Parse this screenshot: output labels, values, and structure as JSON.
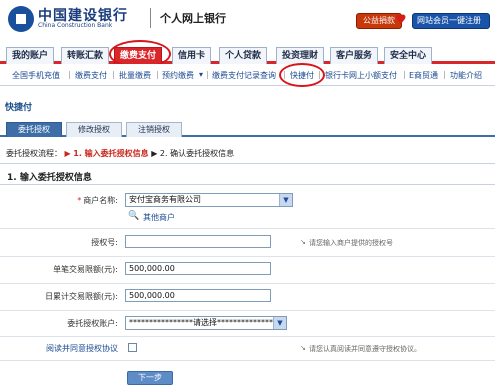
{
  "header": {
    "bank_name_cn": "中国建设银行",
    "bank_name_en": "China Construction Bank",
    "portal_title": "个人网上银行",
    "welfare_button": "公益捐款",
    "register_button": "网站会员一键注册"
  },
  "main_nav": {
    "tabs": [
      "我的账户",
      "转账汇款",
      "缴费支付",
      "信用卡",
      "个人贷款",
      "投资理财",
      "客户服务",
      "安全中心"
    ],
    "active": "缴费支付"
  },
  "sub_nav": {
    "items": [
      "全国手机充值",
      "缴费支付",
      "批量缴费",
      "预约缴费",
      "缴费支付记录查询",
      "快捷付",
      "银行卡网上小额支付",
      "E商贸通",
      "功能介绍"
    ],
    "highlighted": "快捷付",
    "dropdown_marker": "▾"
  },
  "page": {
    "title": "快捷付",
    "subtabs": [
      "委托授权",
      "修改授权",
      "注销授权"
    ],
    "active_subtab": "委托授权",
    "flow_prefix": "委托授权流程：",
    "flow_current": "1. 输入委托授权信息",
    "flow_arrow": "▶",
    "flow_next": "2. 确认委托授权信息",
    "section_title": "1. 输入委托授权信息"
  },
  "form": {
    "merchant_label": "商户名称:",
    "merchant_value": "安付宝商务有限公司",
    "other_merchant": "其他商户",
    "auth_no_label": "授权号:",
    "auth_no_value": "",
    "auth_no_hint": "请您输入商户提供的授权号",
    "single_limit_label": "单笔交易限额(元):",
    "single_limit_value": "500,000.00",
    "daily_limit_label": "日累计交易限额(元):",
    "daily_limit_value": "500,000.00",
    "account_label": "委托授权账户:",
    "account_value": "****************请选择****************",
    "agree_label": "阅读并同意授权协议",
    "agree_hint": "请您认真阅读并同意遵守授权协议。",
    "next_button": "下一步",
    "required_mark": "*",
    "hint_marker": "↘"
  },
  "colors": {
    "brand_red": "#d8262b",
    "brand_blue": "#1a4f9c",
    "tab_blue": "#3e6ea8"
  }
}
